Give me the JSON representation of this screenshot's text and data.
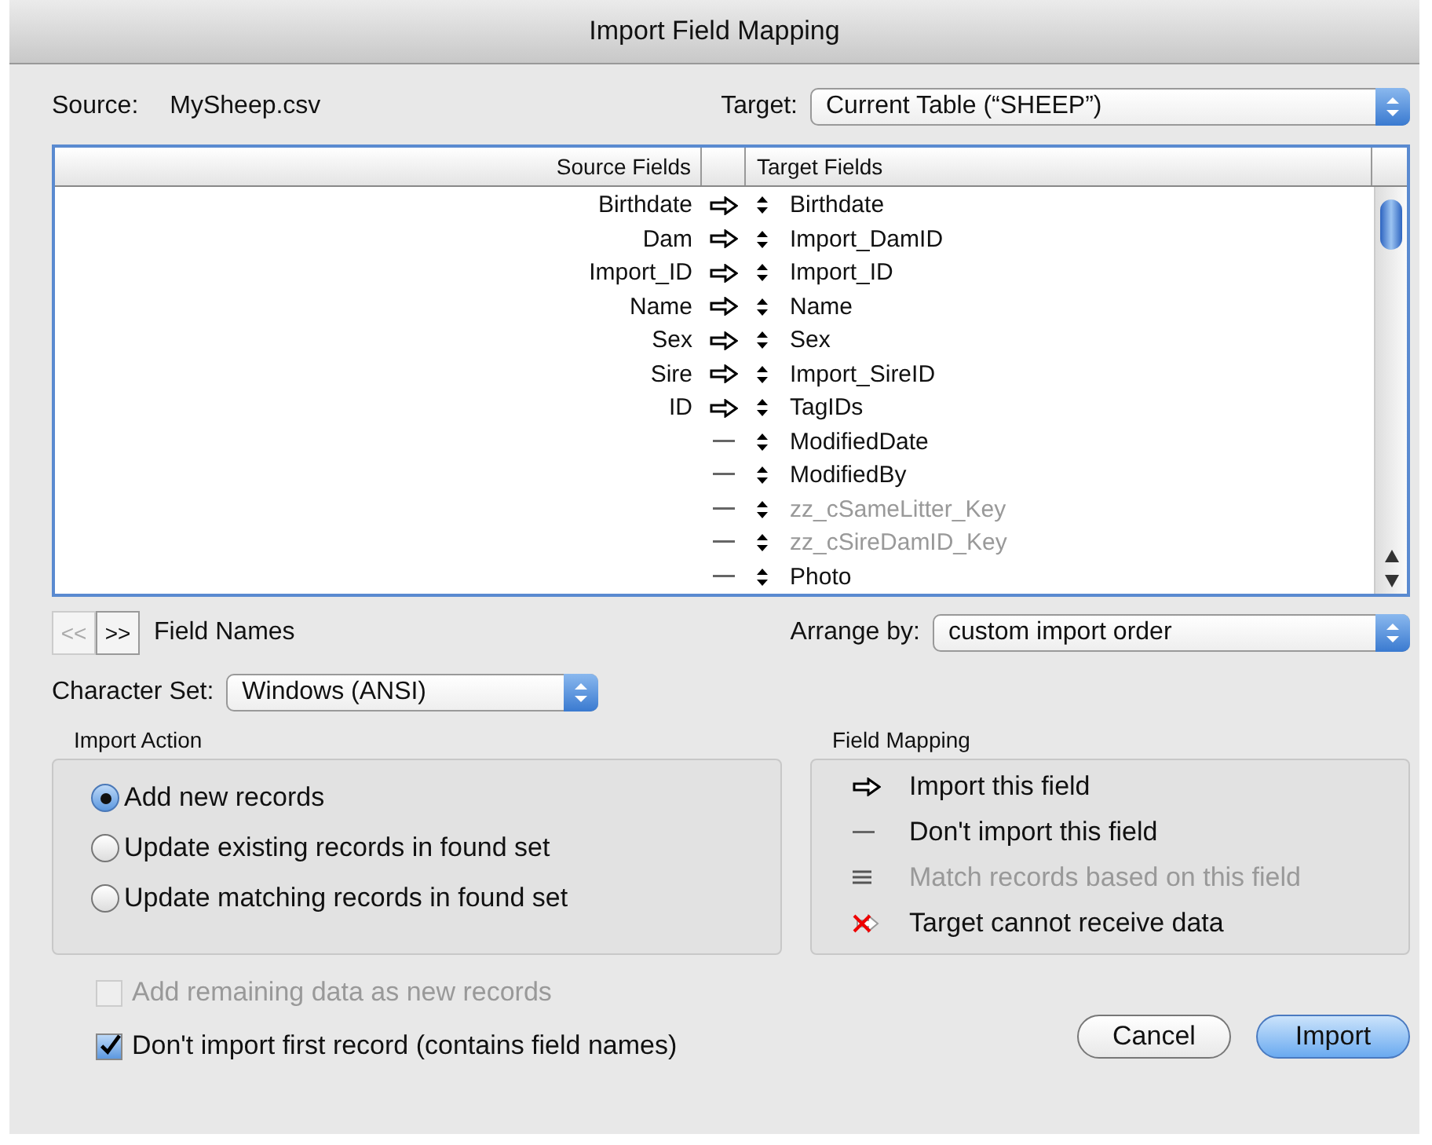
{
  "window": {
    "title": "Import Field Mapping"
  },
  "source": {
    "label": "Source:",
    "value": "MySheep.csv"
  },
  "target": {
    "label": "Target:",
    "value": "Current Table (“SHEEP”)"
  },
  "table": {
    "columns": [
      "Source Fields",
      "Target Fields"
    ],
    "rows": [
      {
        "source": "Birthdate",
        "kind": "import",
        "target": "Birthdate",
        "disabled": false
      },
      {
        "source": "Dam",
        "kind": "import",
        "target": "Import_DamID",
        "disabled": false
      },
      {
        "source": "Import_ID",
        "kind": "import",
        "target": "Import_ID",
        "disabled": false
      },
      {
        "source": "Name",
        "kind": "import",
        "target": "Name",
        "disabled": false
      },
      {
        "source": "Sex",
        "kind": "import",
        "target": "Sex",
        "disabled": false
      },
      {
        "source": "Sire",
        "kind": "import",
        "target": "Import_SireID",
        "disabled": false
      },
      {
        "source": "ID",
        "kind": "import",
        "target": "TagIDs",
        "disabled": false
      },
      {
        "kind": "skip",
        "target": "ModifiedDate",
        "disabled": false
      },
      {
        "kind": "skip",
        "target": "ModifiedBy",
        "disabled": false
      },
      {
        "kind": "skip",
        "target": "zz_cSameLitter_Key",
        "disabled": true
      },
      {
        "kind": "skip",
        "target": "zz_cSireDamID_Key",
        "disabled": true
      },
      {
        "kind": "skip",
        "target": "Photo",
        "disabled": false
      }
    ]
  },
  "record_nav": {
    "prev": "<<",
    "next": ">>",
    "prev_disabled": true,
    "label": "Field Names"
  },
  "arrange_by": {
    "label": "Arrange by:",
    "value": "custom import order"
  },
  "character_set": {
    "label": "Character Set:",
    "value": "Windows (ANSI)"
  },
  "import_action": {
    "title": "Import Action",
    "options": [
      {
        "label": "Add new records",
        "selected": true
      },
      {
        "label": "Update existing records in found set",
        "selected": false
      },
      {
        "label": "Update matching records in found set",
        "selected": false
      }
    ]
  },
  "field_mapping_legend": {
    "title": "Field Mapping",
    "items": [
      {
        "kind": "import",
        "label": "Import this field",
        "disabled": false
      },
      {
        "kind": "skip",
        "label": "Don't import this field",
        "disabled": false
      },
      {
        "kind": "match",
        "label": "Match records based on this field",
        "disabled": true
      },
      {
        "kind": "cannot",
        "label": "Target cannot receive data",
        "disabled": false
      }
    ]
  },
  "checkboxes": [
    {
      "label": "Add remaining data as new records",
      "checked": false,
      "disabled": true
    },
    {
      "label": "Don't import first record (contains field names)",
      "checked": true,
      "disabled": false
    }
  ],
  "buttons": [
    {
      "label": "Cancel",
      "default": false
    },
    {
      "label": "Import",
      "default": true
    }
  ]
}
